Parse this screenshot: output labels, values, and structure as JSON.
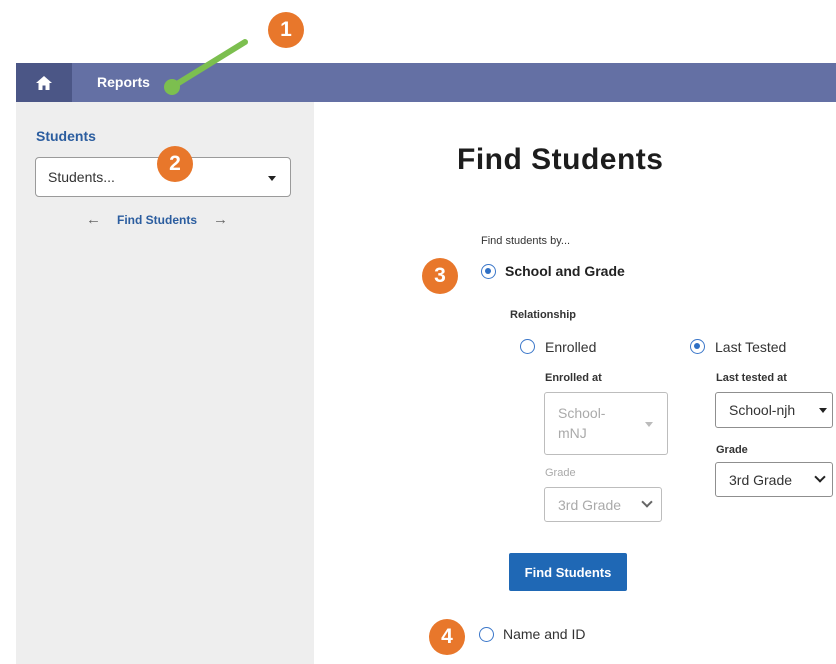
{
  "nav": {
    "home_icon": "home-icon",
    "reports_label": "Reports",
    "bar_color": "#6470a4"
  },
  "sidebar": {
    "title": "Students",
    "student_select": {
      "value": "Students..."
    },
    "pager": {
      "prev_icon": "arrow-left-icon",
      "label": "Find Students",
      "next_icon": "arrow-right-icon"
    }
  },
  "main": {
    "title": "Find Students",
    "find_by_label": "Find students by...",
    "options": {
      "school_grade": {
        "label": "School and Grade",
        "checked": true
      },
      "name_id": {
        "label": "Name and ID",
        "checked": false
      }
    },
    "relationship": {
      "label": "Relationship",
      "enrolled": {
        "label": "Enrolled",
        "checked": false,
        "enrolled_at_label": "Enrolled at",
        "school_value_line1": "School-",
        "school_value_line2": "mNJ",
        "grade_label": "Grade",
        "grade_value": "3rd Grade"
      },
      "last_tested": {
        "label": "Last Tested",
        "checked": true,
        "last_tested_at_label": "Last tested at",
        "school_value": "School-njh",
        "grade_label": "Grade",
        "grade_value": "3rd Grade"
      }
    },
    "find_button_label": "Find Students"
  },
  "annotations": {
    "badges": [
      "1",
      "2",
      "3",
      "4"
    ],
    "badge_color": "#e8772b",
    "pointer_color": "#7cbf4f"
  }
}
